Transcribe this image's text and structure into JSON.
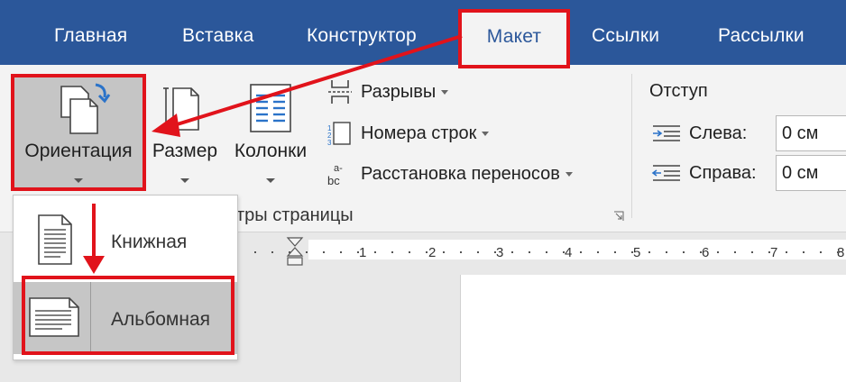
{
  "tabs": [
    {
      "label": "Главная"
    },
    {
      "label": "Вставка"
    },
    {
      "label": "Конструктор"
    },
    {
      "label": "Макет"
    },
    {
      "label": "Ссылки"
    },
    {
      "label": "Рассылки"
    }
  ],
  "page_setup": {
    "orientation_label": "Ориентация",
    "size_label": "Размер",
    "columns_label": "Колонки",
    "breaks_label": "Разрывы",
    "line_numbers_label": "Номера строк",
    "hyphenation_label": "Расстановка переносов",
    "group_label_partial": "тры страницы"
  },
  "indent": {
    "title": "Отступ",
    "left_label": "Слева:",
    "left_value": "0 см",
    "right_label": "Справа:",
    "right_value": "0 см"
  },
  "orientation_menu": {
    "portrait_label": "Книжная",
    "landscape_label": "Альбомная",
    "selected": "Альбомная"
  },
  "ruler": {
    "ticks": [
      "1",
      "2",
      "3",
      "4",
      "5",
      "6",
      "7",
      "8"
    ]
  },
  "icons": {
    "orientation": "orientation-icon",
    "size": "page-size-icon",
    "columns": "columns-icon",
    "breaks": "breaks-icon",
    "line_numbers": "line-numbers-icon",
    "hyphenation": "hyphenation-icon",
    "indent_left": "indent-left-icon",
    "indent_right": "indent-right-icon",
    "portrait": "portrait-page-icon",
    "landscape": "landscape-page-icon"
  },
  "colors": {
    "ribbon_blue": "#2b579a",
    "highlight_red": "#e1131b",
    "selected_gray": "#c6c6c6"
  }
}
